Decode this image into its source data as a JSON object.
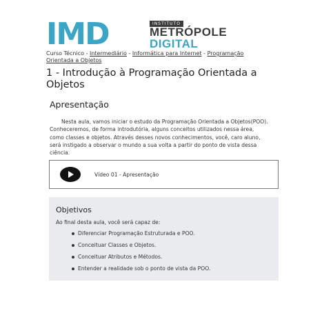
{
  "logo": {
    "imd": "IMD",
    "institute": "INSTITUTO",
    "line1": "METRÓPOLE",
    "line2": "DIGITAL"
  },
  "breadcrumb": {
    "prefix": "Curso Técnico - ",
    "items": [
      "Intermediário",
      "Informática para Internet",
      "Programação Orientada a Objetos"
    ],
    "separator": " - "
  },
  "page_title": "1 - Introdução à Programação Orientada a Objetos",
  "presentation": {
    "heading": "Apresentação",
    "text": "Nesta aula, vamos iniciar o estudo da Programação Orientada a Objetos(POO). Conheceremos, de forma introdutória, alguns conceitos utilizados nessa área, como classes e objetos. Através desses novos conhecimentos, você, caro aluno, será instigado a observar o mundo a sua volta a partir do ponto de vista dessa ciência."
  },
  "video": {
    "label": "Vídeo 01 - Apresentação"
  },
  "objectives": {
    "heading": "Objetivos",
    "intro": "Ao final desta aula, você será capaz de:",
    "items": [
      "Diferenciar Programação Estruturada e POO.",
      "Conceituar Classes e Objetos.",
      "Conceituar Atributos e Métodos.",
      "Entender a realidade sob o ponto de vista da POO."
    ]
  },
  "colors": {
    "brand_blue": "#3aa5c4",
    "brand_dark": "#3a3a3a",
    "objectives_bg": "#e8ecef"
  }
}
